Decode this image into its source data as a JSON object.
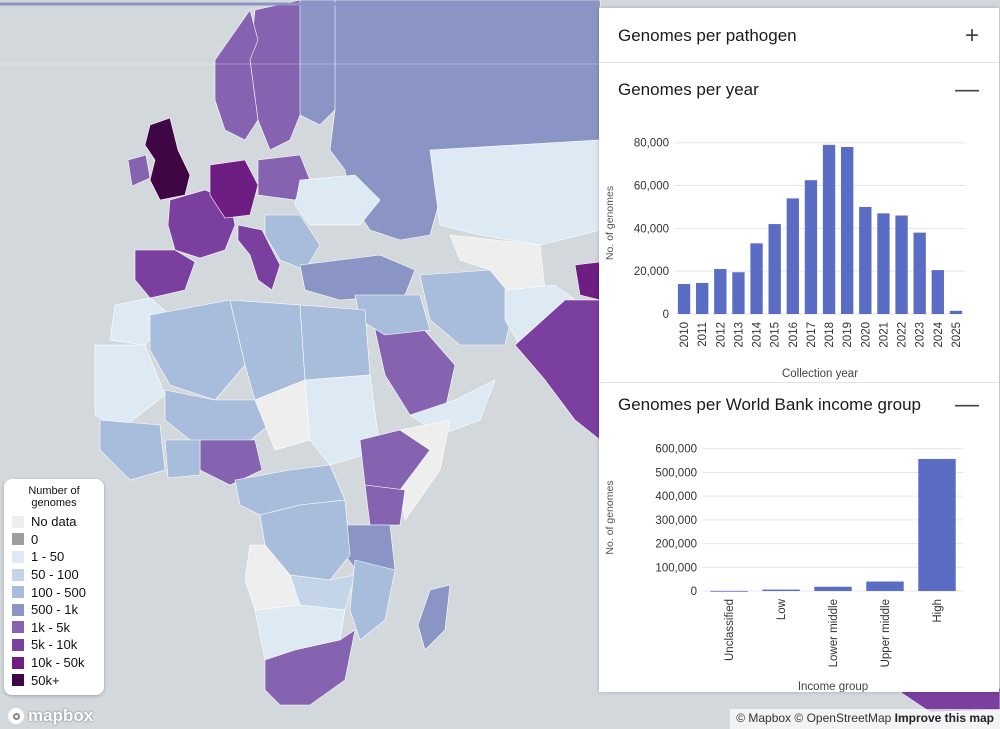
{
  "map": {
    "colors": {
      "sea": "#d3d8dc",
      "nodata": "#eeeeee",
      "c1_50": "#deeaf3",
      "c50_100": "#c4d5ea",
      "c100_500": "#a8bcdb",
      "c500_1k": "#8a95c5",
      "c1k_5k": "#8663b1",
      "c5k_10k": "#7a3f9f",
      "c10k_50k": "#6e1d83",
      "c50k": "#3f0545"
    }
  },
  "legend": {
    "title": "Number of genomes",
    "items": [
      {
        "label": "No data",
        "color": "#eeeeee"
      },
      {
        "label": "0",
        "color": "#9e9e9e"
      },
      {
        "label": "1 - 50",
        "color": "#deeaf3"
      },
      {
        "label": "50 - 100",
        "color": "#c4d5ea"
      },
      {
        "label": "100 - 500",
        "color": "#a8bcdb"
      },
      {
        "label": "500 - 1k",
        "color": "#8a95c5"
      },
      {
        "label": "1k - 5k",
        "color": "#8663b1"
      },
      {
        "label": "5k - 10k",
        "color": "#7a3f9f"
      },
      {
        "label": "10k - 50k",
        "color": "#6e1d83"
      },
      {
        "label": "50k+",
        "color": "#3f0545"
      }
    ]
  },
  "attribution": {
    "mapbox": "© Mapbox",
    "osm": "© OpenStreetMap",
    "improve": "Improve this map",
    "logo": "mapbox"
  },
  "panel": {
    "sections": [
      {
        "title": "Genomes per pathogen",
        "toggle": "+"
      },
      {
        "title": "Genomes per year",
        "toggle": "—"
      },
      {
        "title": "Genomes per World Bank income group",
        "toggle": "—"
      }
    ]
  },
  "chart_data": [
    {
      "type": "bar",
      "title": "",
      "xlabel": "Collection year",
      "ylabel": "No. of genomes",
      "categories": [
        "2010",
        "2011",
        "2012",
        "2013",
        "2014",
        "2015",
        "2016",
        "2017",
        "2018",
        "2019",
        "2020",
        "2021",
        "2022",
        "2023",
        "2024",
        "2025"
      ],
      "values": [
        14000,
        14500,
        21000,
        19500,
        33000,
        42000,
        54000,
        62500,
        79000,
        78000,
        50000,
        47000,
        46000,
        38000,
        20500,
        1500
      ],
      "ylim": [
        0,
        85000
      ],
      "yticks": [
        "0",
        "20,000",
        "40,000",
        "60,000",
        "80,000"
      ],
      "grid": true,
      "color": "#5b6cc4"
    },
    {
      "type": "bar",
      "title": "",
      "xlabel": "Income group",
      "ylabel": "No. of genomes",
      "categories": [
        "Unclassified",
        "Low",
        "Lower middle",
        "Upper middle",
        "High"
      ],
      "values": [
        500,
        6000,
        18000,
        40000,
        557000
      ],
      "ylim": [
        0,
        620000
      ],
      "yticks": [
        "0",
        "100,000",
        "200,000",
        "300,000",
        "400,000",
        "500,000",
        "600,000"
      ],
      "grid": true,
      "color": "#5b6cc4"
    }
  ]
}
